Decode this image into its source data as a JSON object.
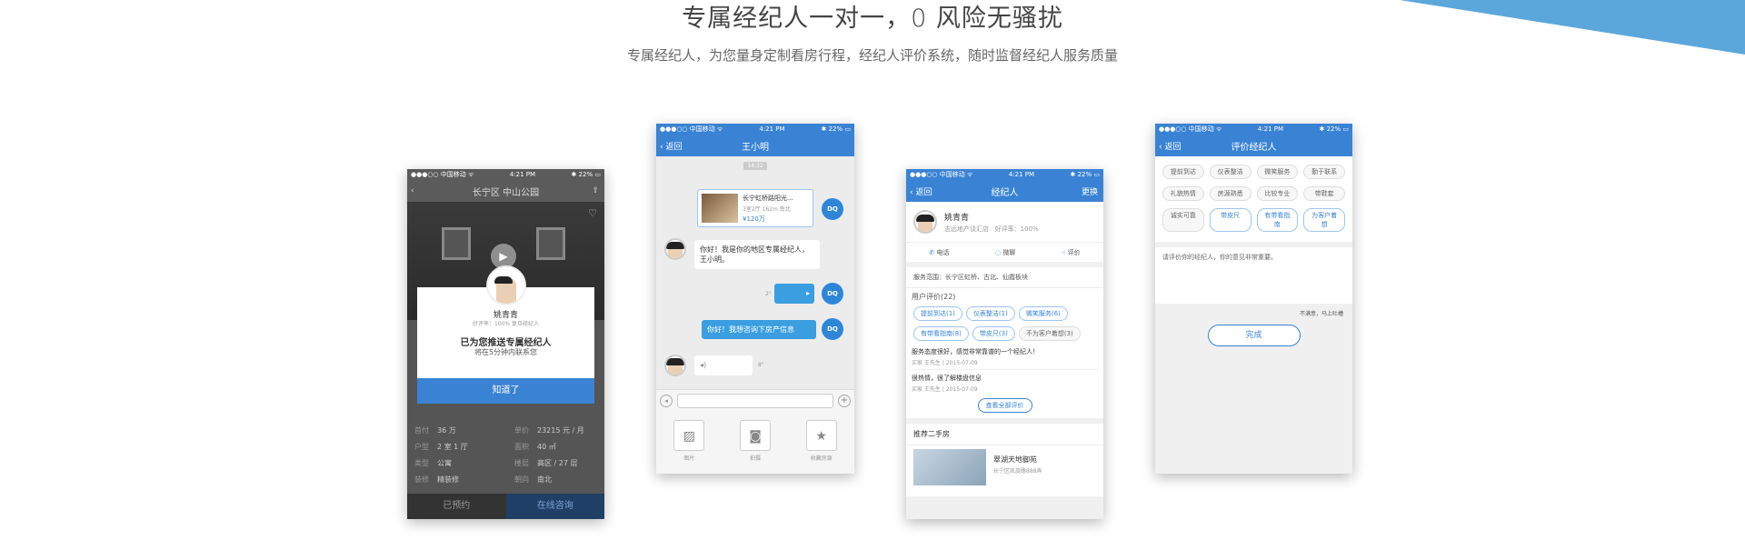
{
  "header": {
    "title": "专属经纪人一对一，0 风险无骚扰",
    "subtitle": "专属经纪人，为您量身定制看房行程，经纪人评价系统，随时监督经纪人服务质量"
  },
  "status": {
    "carrier": "●●●○○ 中国移动 ᯤ",
    "time": "4:21 PM",
    "battery": "✱ 22% ▭"
  },
  "phone1": {
    "nav_title": "长宁区 中山公园",
    "agent_name": "姚青青",
    "agent_meta": "好评率：100%    复旦经纪人",
    "pushed_text": "已为您推送专属经纪人",
    "contact_text": "将在5分钟内联系您",
    "ok_button": "知道了",
    "info": [
      {
        "k": "首付",
        "v": "36 万",
        "k2": "单价",
        "v2": "23215 元 / 月"
      },
      {
        "k": "户型",
        "v": "2 室 1 厅",
        "k2": "面积",
        "v2": "40 ㎡"
      },
      {
        "k": "类型",
        "v": "公寓",
        "k2": "楼层",
        "v2": "高区 / 27 层"
      },
      {
        "k": "装修",
        "v": "精装修",
        "k2": "朝向",
        "v2": "南北"
      }
    ],
    "btn_booked": "已预约",
    "btn_consult": "在线咨询"
  },
  "phone2": {
    "back": "返回",
    "nav_title": "王小明",
    "time_tag": "14:32",
    "card_title": "长宁虹桥路阳光...",
    "card_meta": "3室2厅 162m 南北",
    "card_price": "¥120万",
    "msg_agent": "你好！我是你的地区专属经纪人，王小明。",
    "voice_len_out": "2\"",
    "msg_user": "你好！我想咨询下房产信息",
    "voice_len_in": "8\"",
    "tools": [
      "图片",
      "拍摄",
      "收藏房源"
    ]
  },
  "phone3": {
    "back": "返回",
    "nav_title": "经纪人",
    "nav_right": "更换",
    "agent_name": "姚青青",
    "agent_company": "志远地产谈汇店",
    "agent_rate": "好评率：100%",
    "actions": [
      "电话",
      "微聊",
      "评价"
    ],
    "service_area": "服务范围：长宁区虹桥、古北、仙霞板块",
    "reviews_title": "用户评价(22)",
    "review_tags": [
      "提前到达(1)",
      "仪表整洁(1)",
      "微笑服务(6)",
      "有带看指南(8)",
      "带皮尺(3)",
      "不为客户着想(3)"
    ],
    "reviews": [
      {
        "text": "服务态度很好，感觉非常靠谱的一个经纪人！",
        "meta": "买家  王先生  |  2015-07-09"
      },
      {
        "text": "很热情，很了解楼盘信息",
        "meta": "买家  王先生  |  2015-07-09"
      }
    ],
    "view_all": "查看全部评价",
    "recommend_title": "推荐二手房",
    "house_name": "翠湖天地御苑",
    "house_addr": "长宁区凯旋路888弄"
  },
  "phone4": {
    "back": "返回",
    "nav_title": "评价经纪人",
    "tags": [
      {
        "label": "提前到达",
        "active": false
      },
      {
        "label": "仪表整洁",
        "active": false
      },
      {
        "label": "微笑服务",
        "active": false
      },
      {
        "label": "勤于联系",
        "active": false
      },
      {
        "label": "礼貌热情",
        "active": false
      },
      {
        "label": "房源熟悉",
        "active": false
      },
      {
        "label": "比较专业",
        "active": false
      },
      {
        "label": "带鞋套",
        "active": false
      },
      {
        "label": "诚实可靠",
        "active": false
      },
      {
        "label": "带皮尺",
        "active": true
      },
      {
        "label": "有带看指南",
        "active": true
      },
      {
        "label": "为客户着想",
        "active": true
      }
    ],
    "placeholder": "请评价你的经纪人，你的意见非常重要。",
    "hint": "不满意，马上吐槽",
    "done": "完成"
  }
}
